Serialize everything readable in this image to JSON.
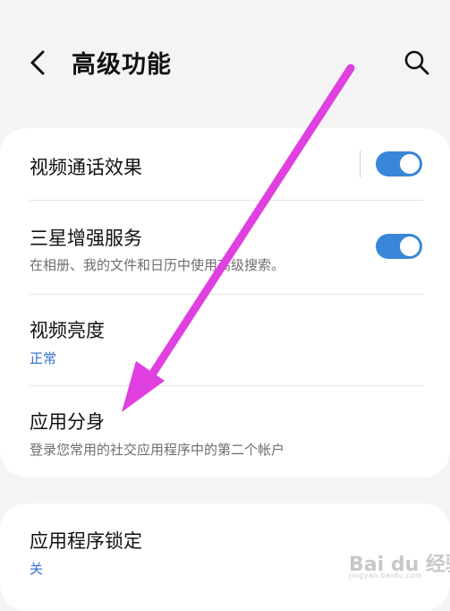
{
  "header": {
    "title": "高级功能",
    "back_icon": "chevron-left-icon",
    "search_icon": "search-icon"
  },
  "settings": [
    {
      "title": "视频通话效果",
      "subtitle": "",
      "toggle": true,
      "toggle_on": true
    },
    {
      "title": "三星增强服务",
      "subtitle": "在相册、我的文件和日历中使用高级搜索。",
      "toggle": true,
      "toggle_on": true
    },
    {
      "title": "视频亮度",
      "subtitle": "正常",
      "toggle": false
    },
    {
      "title": "应用分身",
      "subtitle": "登录您常用的社交应用程序中的第二个帐户",
      "toggle": false
    }
  ],
  "settings2": [
    {
      "title": "应用程序锁定",
      "subtitle": "关",
      "toggle": false
    }
  ],
  "colors": {
    "accent": "#3a86d8",
    "arrow": "#e040e0",
    "background": "#f4f4f4",
    "card": "#ffffff"
  },
  "watermark": {
    "logo": "Bai du 经验",
    "sub": "jingyan.baidu.com"
  }
}
